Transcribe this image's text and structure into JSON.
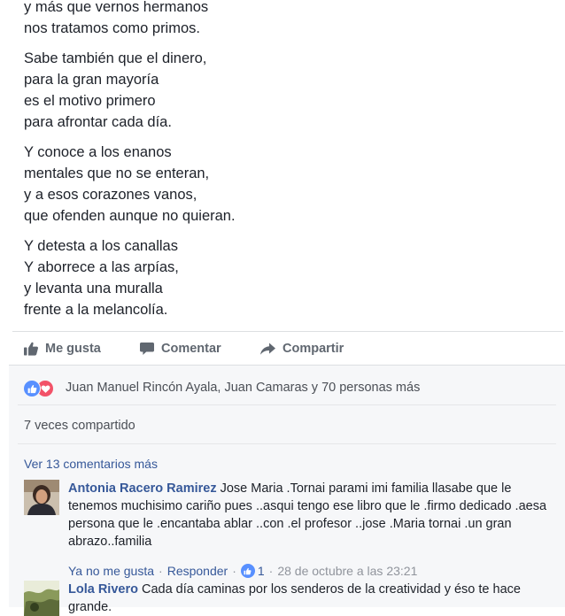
{
  "poem": {
    "stanzas": [
      [
        "y más que vernos hermanos",
        "nos tratamos como primos."
      ],
      [
        "Sabe también que el dinero,",
        "para la gran mayoría",
        "es el motivo primero",
        "para afrontar cada día."
      ],
      [
        "Y conoce a los enanos",
        "mentales que no se enteran,",
        "y a esos corazones vanos,",
        "que ofenden aunque no quieran."
      ],
      [
        "Y detesta a los canallas",
        "Y aborrece a las arpías,",
        "y levanta una muralla",
        "frente a la melancolía."
      ]
    ]
  },
  "actions": {
    "like_label": "Me gusta",
    "comment_label": "Comentar",
    "share_label": "Compartir",
    "like_icon": "thumbs-up-icon",
    "comment_icon": "speech-bubble-icon",
    "share_icon": "share-arrow-icon"
  },
  "reactions": {
    "summary": "Juan Manuel Rincón Ayala, Juan Camaras y 70 personas más",
    "icons": [
      "like-reaction-icon",
      "love-reaction-icon"
    ],
    "like_color": "#5890ff",
    "love_color": "#f25268"
  },
  "shares": {
    "text": "7 veces compartido"
  },
  "comments": {
    "more_label": "Ver 13 comentarios más",
    "items": [
      {
        "author": "Antonia Racero Ramirez",
        "text": "Jose Maria .Tornai parami imi familia llasabe que le tenemos muchisimo cariño pues ..asqui tengo ese libro que le .firmo dedicado .aesa persona que le .encantaba ablar ..con .el profesor ..jose .Maria tornai .un gran abrazo..familia",
        "unlike_label": "Ya no me gusta",
        "reply_label": "Responder",
        "reaction_count": "1",
        "timestamp": "28 de octubre a las 23:21"
      },
      {
        "author": "Lola Rivero",
        "text": "Cada día caminas por los senderos de la creatividad y éso te hace grande."
      }
    ]
  },
  "colors": {
    "link": "#365899",
    "text": "#1d2129",
    "muted": "#606770",
    "comments_bg": "#f6f7f9"
  }
}
